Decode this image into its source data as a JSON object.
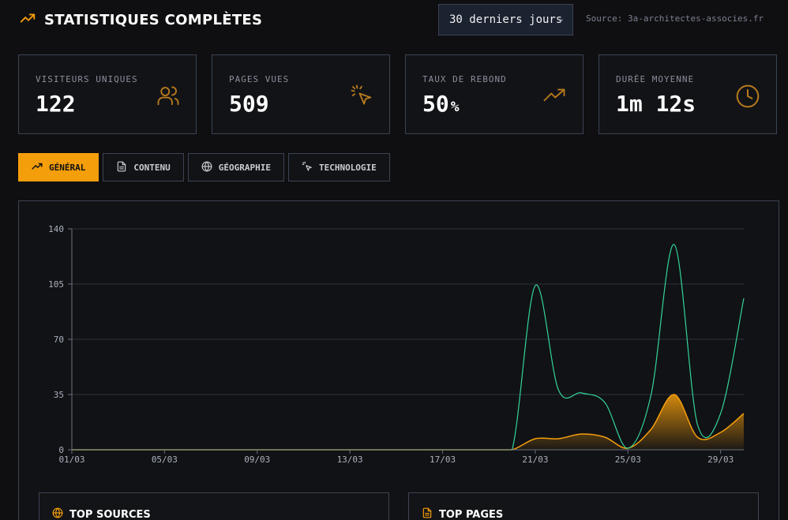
{
  "header": {
    "title": "STATISTIQUES COMPLÈTES",
    "period": "30 derniers jours",
    "source": "Source: 3a-architectes-associes.fr"
  },
  "stats": [
    {
      "label": "VISITEURS UNIQUES",
      "value": "122",
      "icon": "users-icon"
    },
    {
      "label": "PAGES VUES",
      "value": "509",
      "icon": "pointer-click-icon"
    },
    {
      "label": "TAUX DE REBOND",
      "value": "50",
      "unit": "%",
      "icon": "trending-up-icon"
    },
    {
      "label": "DURÉE MOYENNE",
      "value": "1m 12s",
      "icon": "clock-icon"
    }
  ],
  "tabs": [
    {
      "label": "GÉNÉRAL",
      "icon": "trending-up-icon",
      "active": true
    },
    {
      "label": "CONTENU",
      "icon": "document-icon"
    },
    {
      "label": "GÉOGRAPHIE",
      "icon": "globe-icon"
    },
    {
      "label": "TECHNOLOGIE",
      "icon": "pointer-click-icon"
    }
  ],
  "colors": {
    "accent": "#f59e0b",
    "series_green": "#34d399",
    "series_orange": "#f59e0b"
  },
  "chart_data": {
    "type": "area",
    "x": [
      "01/03",
      "02/03",
      "03/03",
      "04/03",
      "05/03",
      "06/03",
      "07/03",
      "08/03",
      "09/03",
      "10/03",
      "11/03",
      "12/03",
      "13/03",
      "14/03",
      "15/03",
      "16/03",
      "17/03",
      "18/03",
      "19/03",
      "20/03",
      "21/03",
      "22/03",
      "23/03",
      "24/03",
      "25/03",
      "26/03",
      "27/03",
      "28/03",
      "29/03",
      "30/03"
    ],
    "xticks": [
      "01/03",
      "05/03",
      "09/03",
      "13/03",
      "17/03",
      "21/03",
      "25/03",
      "29/03"
    ],
    "yticks": [
      0,
      35,
      70,
      105,
      140
    ],
    "ylim": [
      0,
      140
    ],
    "grid": true,
    "series": [
      {
        "values": [
          0,
          0,
          0,
          0,
          0,
          0,
          0,
          0,
          0,
          0,
          0,
          0,
          0,
          0,
          0,
          0,
          0,
          0,
          0,
          0,
          104,
          38,
          36,
          30,
          1,
          35,
          130,
          16,
          23,
          96
        ]
      },
      {
        "values": [
          0,
          0,
          0,
          0,
          0,
          0,
          0,
          0,
          0,
          0,
          0,
          0,
          0,
          0,
          0,
          0,
          0,
          0,
          0,
          0,
          7,
          7,
          10,
          8,
          1,
          13,
          35,
          8,
          11,
          23
        ]
      }
    ]
  },
  "panels": [
    {
      "title": "TOP SOURCES",
      "icon": "globe-icon"
    },
    {
      "title": "TOP PAGES",
      "icon": "document-icon"
    }
  ]
}
